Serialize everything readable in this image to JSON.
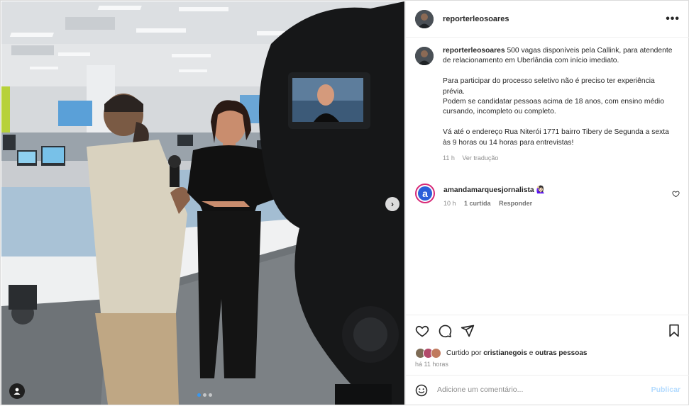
{
  "post": {
    "username": "reporterleosoares",
    "more_label": "•••",
    "caption": {
      "username": "reporterleosoares",
      "line1": "500 vagas disponíveis pela Callink, para atendente de relacionamento em Uberlândia com início imediato.",
      "line2": "Para participar do processo seletivo não é preciso ter experiência prévia.",
      "line3": "Podem se candidatar pessoas acima de 18 anos, com ensino médio cursando, incompleto ou completo.",
      "line4": "Vá até o endereço Rua Niterói 1771 bairro Tibery de Segunda a sexta às 9 horas ou 14 horas para entrevistas!",
      "time": "11 h",
      "translate": "Ver tradução"
    },
    "comment": {
      "avatar_letter": "a",
      "username": "amandamarquesjornalista",
      "emoji": "🙋🏻‍♀️",
      "time": "10 h",
      "likes": "1 curtida",
      "reply": "Responder"
    },
    "likes": {
      "prefix": "Curtido por",
      "user": "cristianegois",
      "connector": "e",
      "others": "outras pessoas"
    },
    "time_ago": "há 11 horas",
    "comment_input": {
      "placeholder": "Adicione um comentário..."
    },
    "publish_label": "Publicar",
    "carousel": {
      "total": 3,
      "current": 1
    }
  },
  "icons": [
    "next-arrow-icon",
    "user-tag-icon",
    "heart-icon",
    "comment-icon",
    "share-icon",
    "bookmark-icon",
    "emoji-icon",
    "small-heart-icon",
    "more-options-icon"
  ],
  "colors": {
    "accent_blue": "#3897f0",
    "publish_disabled": "#b3dbff",
    "ring": "#d62976",
    "avatar_a": "#2b5fd9"
  }
}
